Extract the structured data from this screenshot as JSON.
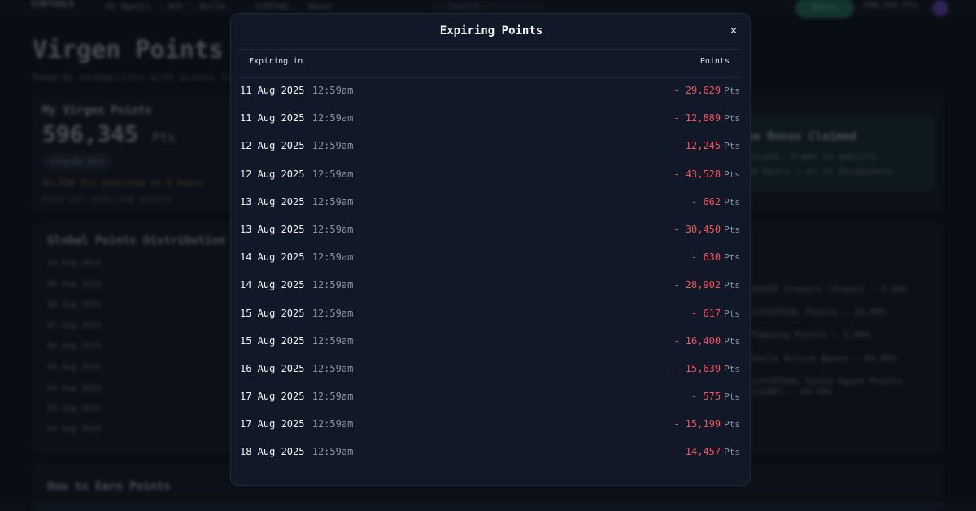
{
  "background": {
    "nav": {
      "logo": "VIRTUALS",
      "items": [
        "AI Agents",
        "ACP",
        "Build",
        "VIRTUAL",
        "About"
      ],
      "search_placeholder": "Search...",
      "cta_label": "Refer",
      "points_pill": "596,345 Pts"
    },
    "page_title": "Virgen Points",
    "page_subtitle": "Rewards evangelists with access to p",
    "my_points": {
      "heading": "My Virgen Points",
      "total": "596,345",
      "unit": "Pts",
      "button": "Change Hex",
      "expiring_note": "42,558 Pts expiring in 9 hours",
      "link": "View all expiring points"
    },
    "bonus_card": {
      "title": "ve Bonus Claimed",
      "line1": "ticate. Trade to amplify.",
      "line2": "24 hours – or it disappears."
    },
    "distribution": {
      "heading": "Global Points Distribution",
      "dates": [
        "10 Aug 2025",
        "09 Aug 2025",
        "08 Aug 2025",
        "07 Aug 2025",
        "06 Aug 2025",
        "05 Aug 2025",
        "04 Aug 2025",
        "03 Aug 2025",
        "02 Aug 2025"
      ]
    },
    "breakdown": [
      "EAGER Stakers (Index) – 5.00%",
      "stVIRTUAL Points – 20.00%",
      "Tapping Points – 1.00%",
      "Daily Active Bonus – 84.00%",
      "stVIRTUAL Voted Agent Points (sVAP) – 10.00%"
    ],
    "earn_heading": "How to Earn Points"
  },
  "modal": {
    "title": "Expiring Points",
    "close_glyph": "×",
    "col_expiring": "Expiring in",
    "col_points": "Points",
    "unit": "Pts",
    "rows": [
      {
        "date": "11 Aug 2025",
        "time": "12:59am",
        "amount": "- 29,629"
      },
      {
        "date": "11 Aug 2025",
        "time": "12:59am",
        "amount": "- 12,889"
      },
      {
        "date": "12 Aug 2025",
        "time": "12:59am",
        "amount": "- 12,245"
      },
      {
        "date": "12 Aug 2025",
        "time": "12:59am",
        "amount": "- 43,528"
      },
      {
        "date": "13 Aug 2025",
        "time": "12:59am",
        "amount": "- 662"
      },
      {
        "date": "13 Aug 2025",
        "time": "12:59am",
        "amount": "- 30,450"
      },
      {
        "date": "14 Aug 2025",
        "time": "12:59am",
        "amount": "- 630"
      },
      {
        "date": "14 Aug 2025",
        "time": "12:59am",
        "amount": "- 28,902"
      },
      {
        "date": "15 Aug 2025",
        "time": "12:59am",
        "amount": "- 617"
      },
      {
        "date": "15 Aug 2025",
        "time": "12:59am",
        "amount": "- 16,400"
      },
      {
        "date": "16 Aug 2025",
        "time": "12:59am",
        "amount": "- 15,639"
      },
      {
        "date": "17 Aug 2025",
        "time": "12:59am",
        "amount": "- 575"
      },
      {
        "date": "17 Aug 2025",
        "time": "12:59am",
        "amount": "- 15,199"
      },
      {
        "date": "18 Aug 2025",
        "time": "12:59am",
        "amount": "- 14,457"
      }
    ]
  },
  "colors": {
    "negative": "#f0545c",
    "modal_bg": "#111827",
    "accent_green": "#2f9e73"
  }
}
